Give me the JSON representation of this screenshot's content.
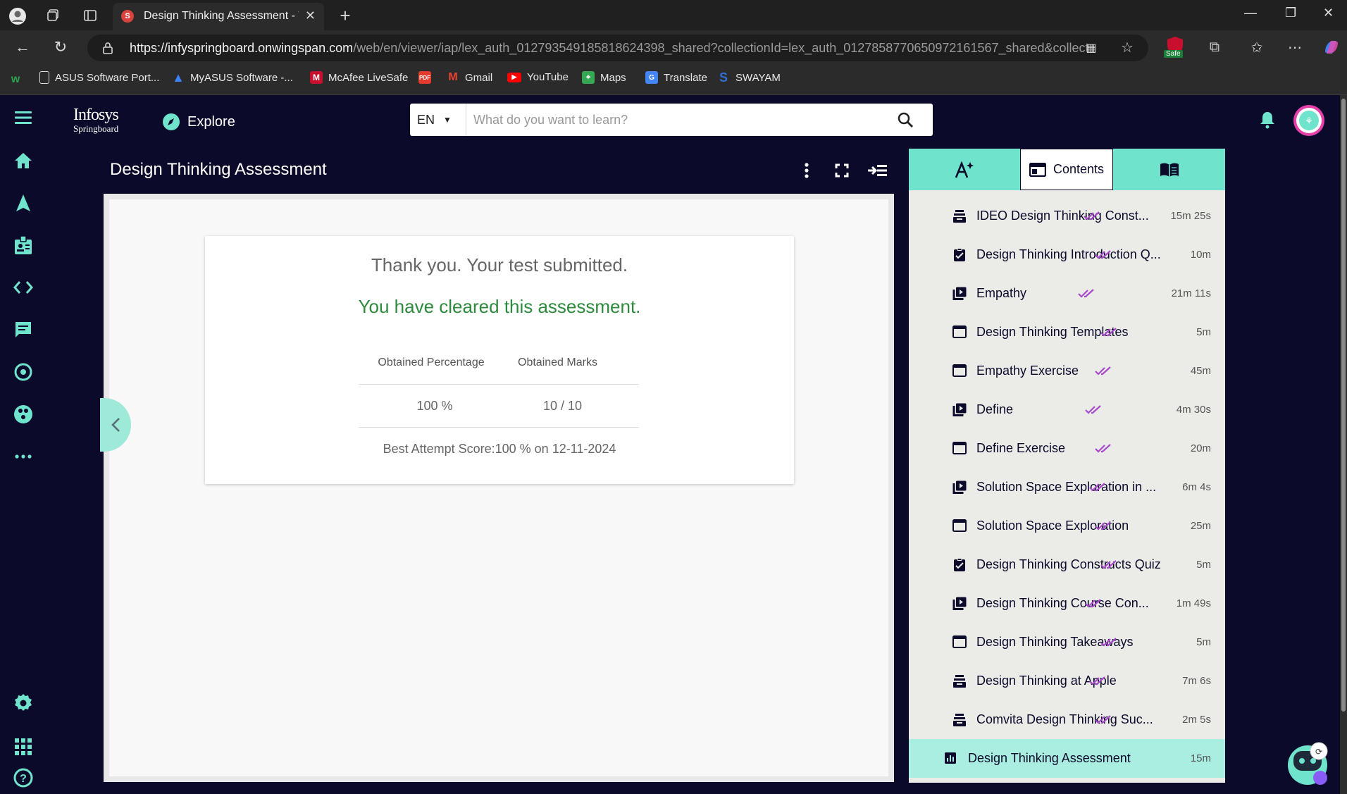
{
  "browser": {
    "tab_title": "Design Thinking Assessment - Vie",
    "tab_favicon": "S",
    "url_host": "https://infyspringboard.onwingspan.com",
    "url_path": "/web/en/viewer/iap/lex_auth_01279354918581862439​8_shared?collectionId=lex_auth_01278587706509721615​67_shared&collecti...",
    "safe_badge": "Safe",
    "bookmarks": [
      {
        "label": "ASUS Software Port...",
        "icon": "page-icon",
        "color": "#dddddd"
      },
      {
        "label": "MyASUS Software -...",
        "icon": "myasus-icon",
        "color": "#3b82f6"
      },
      {
        "label": "McAfee LiveSafe",
        "icon": "mcafee-icon",
        "color": "#c8102e"
      },
      {
        "label": "Gmail",
        "icon": "gmail-icon",
        "color": "#ea4335"
      },
      {
        "label": "YouTube",
        "icon": "youtube-icon",
        "color": "#ff0000"
      },
      {
        "label": "Maps",
        "icon": "maps-icon",
        "color": "#34a853"
      },
      {
        "label": "Translate",
        "icon": "translate-icon",
        "color": "#4285f4"
      },
      {
        "label": "SWAYAM",
        "icon": "swayam-icon",
        "color": "#2f6fd6"
      }
    ]
  },
  "app": {
    "logo_line1": "Infosys",
    "logo_line2": "Springboard",
    "explore_label": "Explore",
    "lang": "EN",
    "search_placeholder": "What do you want to learn?"
  },
  "viewer": {
    "title": "Design Thinking Assessment",
    "thanks": "Thank you. Your test submitted.",
    "cleared": "You have cleared this assessment.",
    "col_percentage": "Obtained Percentage",
    "col_marks": "Obtained Marks",
    "percentage": "100 %",
    "marks": "10 / 10",
    "best_attempt": "Best Attempt Score:100 % on 12-11-2024"
  },
  "panel": {
    "active_tab": "Contents",
    "items": [
      {
        "label": "IDEO Design Thinking Const...",
        "duration": "15m 25s",
        "type": "module-icon"
      },
      {
        "label": "Design Thinking Introduction Q...",
        "duration": "10m",
        "type": "quiz-icon"
      },
      {
        "label": "Empathy",
        "duration": "21m 11s",
        "type": "video-icon"
      },
      {
        "label": "Design Thinking Templates",
        "duration": "5m",
        "type": "page-icon"
      },
      {
        "label": "Empathy Exercise",
        "duration": "45m",
        "type": "page-icon"
      },
      {
        "label": "Define",
        "duration": "4m 30s",
        "type": "video-icon"
      },
      {
        "label": "Define Exercise",
        "duration": "20m",
        "type": "page-icon"
      },
      {
        "label": "Solution Space Exploration in ...",
        "duration": "6m 4s",
        "type": "video-icon"
      },
      {
        "label": "Solution Space Exploration",
        "duration": "25m",
        "type": "page-icon"
      },
      {
        "label": "Design Thinking Constructs Quiz",
        "duration": "5m",
        "type": "quiz-icon"
      },
      {
        "label": "Design Thinking Course Con...",
        "duration": "1m 49s",
        "type": "video-icon"
      },
      {
        "label": "Design Thinking Takeaways",
        "duration": "5m",
        "type": "page-icon"
      },
      {
        "label": "Design Thinking at Apple",
        "duration": "7m 6s",
        "type": "module-icon"
      },
      {
        "label": "Comvita Design Thinking Suc...",
        "duration": "2m 5s",
        "type": "module-icon"
      }
    ],
    "active_item": {
      "label": "Design Thinking Assessment",
      "duration": "15m",
      "type": "assessment-icon"
    }
  },
  "colors": {
    "accent": "#6fe3cb",
    "navy": "#0b0a2b",
    "success": "#2e8b3e",
    "check": "#a64ac9"
  }
}
